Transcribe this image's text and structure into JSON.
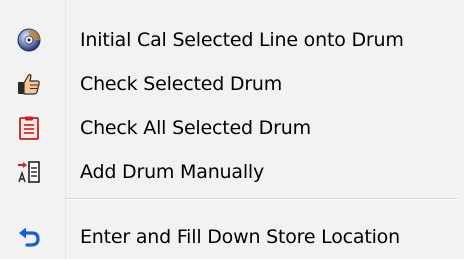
{
  "menu": {
    "items": [
      {
        "label": "Initial Cal Selected Line onto Drum",
        "icon": "disc-cd-icon"
      },
      {
        "label": "Check Selected Drum",
        "icon": "thumbs-up-icon"
      },
      {
        "label": "Check All Selected Drum",
        "icon": "clipboard-checklist-icon"
      },
      {
        "label": "Add Drum Manually",
        "icon": "add-manual-entry-icon"
      },
      {
        "label": "Enter and Fill Down Store Location",
        "icon": "undo-arrow-icon"
      }
    ]
  },
  "colors": {
    "menu_background": "#f2f2f2",
    "separator": "#d6d6d6",
    "accent_blue": "#1a5fd0",
    "accent_red": "#d42020"
  }
}
